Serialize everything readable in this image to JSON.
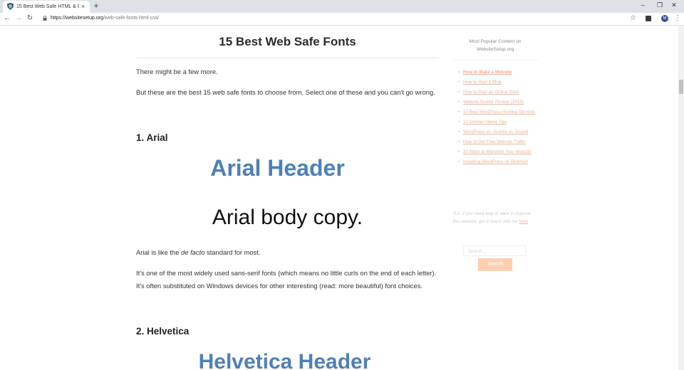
{
  "browser": {
    "tab_title": "15 Best Web Safe HTML & CSS F",
    "tab_close": "×",
    "new_tab": "+",
    "window_controls": [
      "–",
      "❐",
      "✕"
    ],
    "url_host": "https://websitesetup.org",
    "url_path": "/web-safe-fonts-html-css/",
    "avatar_letter": "M",
    "nav_back": "←",
    "nav_forward": "→",
    "nav_reload": "↻",
    "star": "☆",
    "menu": "⋮"
  },
  "article": {
    "title": "15 Best Web Safe Fonts",
    "intro_1": "There might be a few more.",
    "intro_2": "But these are the best 15 web safe fonts to choose from. Select one of these and you can't go wrong.",
    "section_1": {
      "heading": "1. Arial",
      "demo_header": "Arial Header",
      "demo_body": "Arial body copy.",
      "desc_prefix": "Arial is like the ",
      "desc_italic": "de facto",
      "desc_suffix": " standard for most.",
      "desc_2": "It's one of the most widely used sans-serif fonts (which means no little curls on the end of each letter). It's often substituted on Windows devices for other interesting (read: more beautiful) font choices."
    },
    "section_2": {
      "heading": "2. Helvetica",
      "demo_header": "Helvetica Header"
    }
  },
  "sidebar": {
    "title": "Most Popular Content on WebsiteSetup.org",
    "links": [
      "How to Make a Website",
      "How to Start a Blog",
      "How to Start an Online Store",
      "Website Builder Review (2019)",
      "10 Best WordPress Hosting Services",
      "10 Domain Name Tips",
      "WordPress vs. Joomla vs. Drupal",
      "How to Get Free Website Traffic",
      "33 Ways to Monetize Your Website",
      "Installing WordPress on Bluehost"
    ],
    "ps_text": "P.S. If you need help or want to improve this website, get in touch with me ",
    "ps_link": "here",
    "ps_end": ".",
    "search_placeholder": "Search ...",
    "search_button": "Search"
  },
  "colors": {
    "accent_link": "#e8b49c",
    "demo_header": "#4f7fb7",
    "search_button": "#fccfb3"
  }
}
